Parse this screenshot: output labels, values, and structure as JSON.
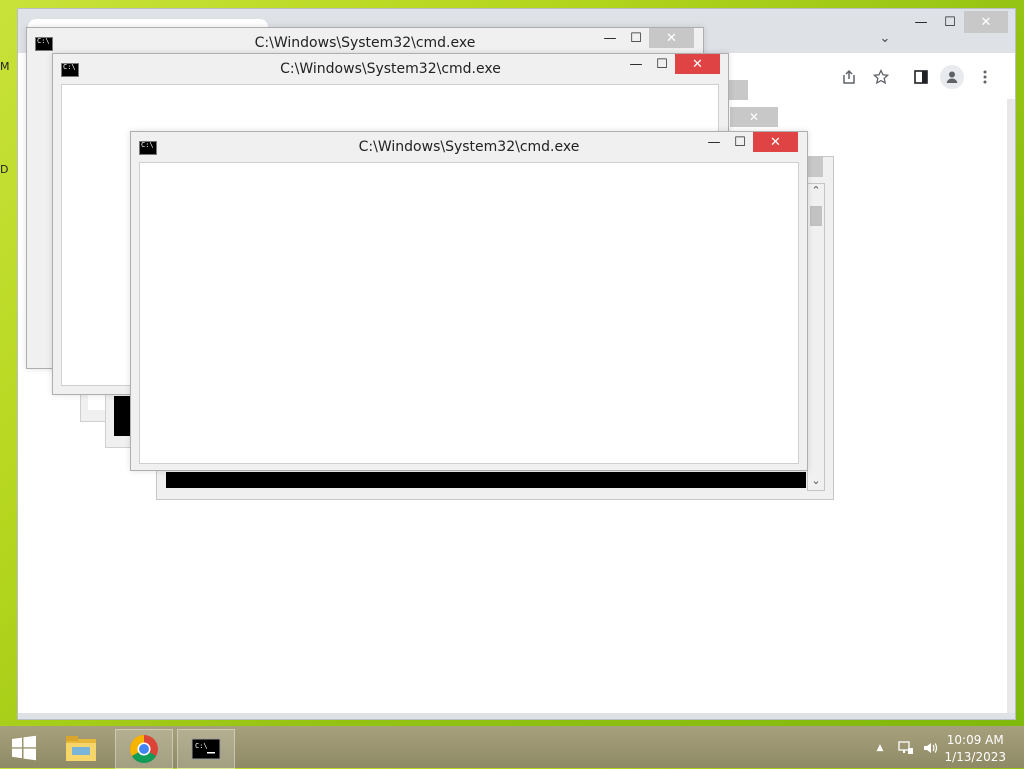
{
  "desktop": {
    "edge_labels": [
      "M",
      "D"
    ]
  },
  "chrome": {
    "title_controls": {
      "minimize": "—",
      "maximize": "☐",
      "close": "✕"
    },
    "tab_dropdown": "⌄",
    "toolbar_icons": [
      "share-icon",
      "star-icon",
      "side-panel-icon",
      "profile-icon",
      "menu-icon"
    ]
  },
  "cmd_windows": [
    {
      "title": "C:\\Windows\\System32\\cmd.exe"
    },
    {
      "title": "C:\\Windows\\System32\\cmd.exe"
    },
    {
      "title": "C:\\Windows\\System32\\cmd.exe"
    }
  ],
  "cmd_controls": {
    "minimize": "—",
    "maximize": "☐",
    "close": "✕"
  },
  "scrollbar": {
    "up": "⌃",
    "down": "⌄"
  },
  "taskbar": {
    "items": [
      "start-icon",
      "file-explorer-icon",
      "chrome-icon",
      "cmd-icon"
    ],
    "tray_arrow": "▲",
    "clock": {
      "time": "10:09 AM",
      "date": "1/13/2023"
    }
  },
  "colors": {
    "close_active": "#e04343",
    "close_inactive": "#c7c7c7",
    "taskbar": "#948f6a"
  }
}
